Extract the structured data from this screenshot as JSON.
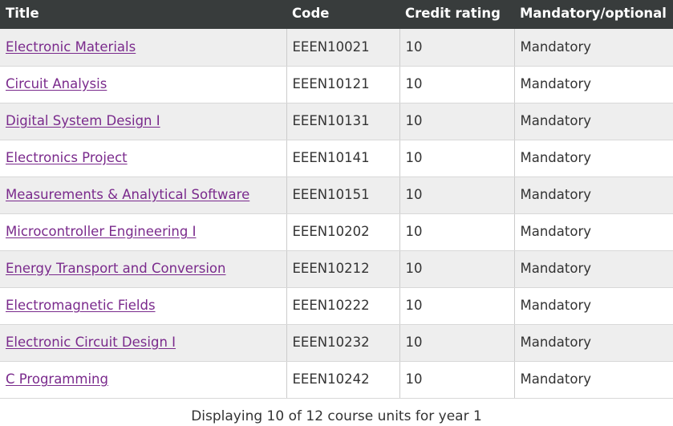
{
  "table": {
    "columns": [
      {
        "key": "title",
        "label": "Title"
      },
      {
        "key": "code",
        "label": "Code"
      },
      {
        "key": "credit",
        "label": "Credit rating"
      },
      {
        "key": "mand",
        "label": "Mandatory/optional"
      }
    ],
    "rows": [
      {
        "title": "Electronic Materials",
        "code": "EEEN10021",
        "credit": "10",
        "mand": "Mandatory"
      },
      {
        "title": "Circuit Analysis",
        "code": "EEEN10121",
        "credit": "10",
        "mand": "Mandatory"
      },
      {
        "title": "Digital System Design I",
        "code": "EEEN10131",
        "credit": "10",
        "mand": "Mandatory"
      },
      {
        "title": "Electronics Project",
        "code": "EEEN10141",
        "credit": "10",
        "mand": "Mandatory"
      },
      {
        "title": "Measurements & Analytical Software",
        "code": "EEEN10151",
        "credit": "10",
        "mand": "Mandatory"
      },
      {
        "title": "Microcontroller Engineering I",
        "code": "EEEN10202",
        "credit": "10",
        "mand": "Mandatory"
      },
      {
        "title": "Energy Transport and Conversion",
        "code": "EEEN10212",
        "credit": "10",
        "mand": "Mandatory"
      },
      {
        "title": "Electromagnetic Fields",
        "code": "EEEN10222",
        "credit": "10",
        "mand": "Mandatory"
      },
      {
        "title": "Electronic Circuit Design I",
        "code": "EEEN10232",
        "credit": "10",
        "mand": "Mandatory"
      },
      {
        "title": "C Programming",
        "code": "EEEN10242",
        "credit": "10",
        "mand": "Mandatory"
      }
    ],
    "caption": "Displaying 10 of 12 course units for year 1"
  },
  "colors": {
    "header_background": "#383c3c",
    "header_text": "#ffffff",
    "row_stripe": "#eeeeee",
    "row_plain": "#ffffff",
    "link": "#7a2a8c",
    "body_text": "#333333",
    "border": "#cccccc"
  }
}
